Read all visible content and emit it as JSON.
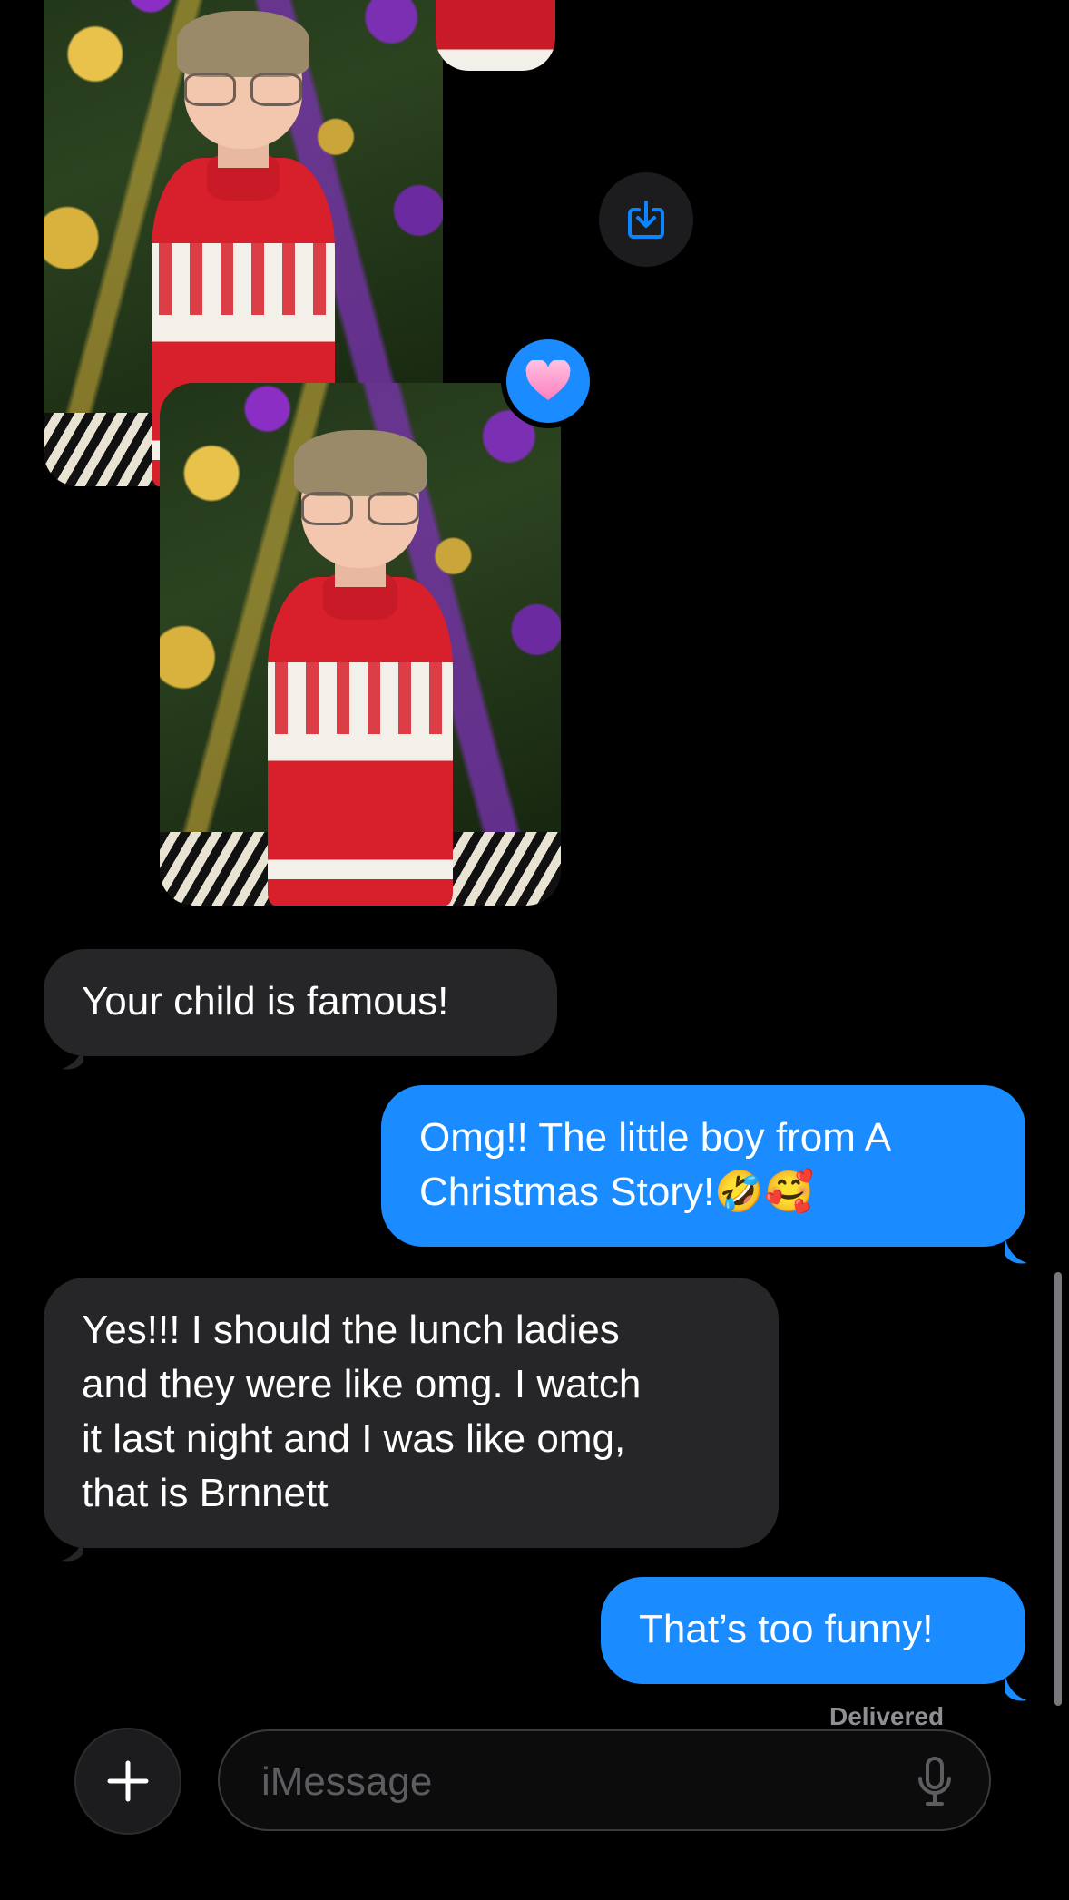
{
  "photos": [
    {
      "name": "top-photo",
      "reaction": ""
    },
    {
      "name": "reacted-photo",
      "reaction": "heart"
    }
  ],
  "icons": {
    "save": "download-icon",
    "reaction": "heart-icon",
    "add": "plus-icon",
    "mic": "microphone-icon"
  },
  "colors": {
    "outgoing": "#1a8cff",
    "incoming": "#262628",
    "reaction": "#ff8fc8",
    "accent": "#0a84ff"
  },
  "messages": [
    {
      "direction": "incoming",
      "text": "Your child is famous!"
    },
    {
      "direction": "outgoing",
      "text": "Omg!! The little boy from A\nChristmas Story!🤣🥰"
    },
    {
      "direction": "incoming",
      "text": "Yes!!! I should the lunch ladies\nand they were like omg. I watch\nit last night and I was like omg,\nthat is Brnnett"
    },
    {
      "direction": "outgoing",
      "text": "That’s too funny!"
    }
  ],
  "status": {
    "delivered": "Delivered"
  },
  "composer": {
    "placeholder": "iMessage"
  }
}
